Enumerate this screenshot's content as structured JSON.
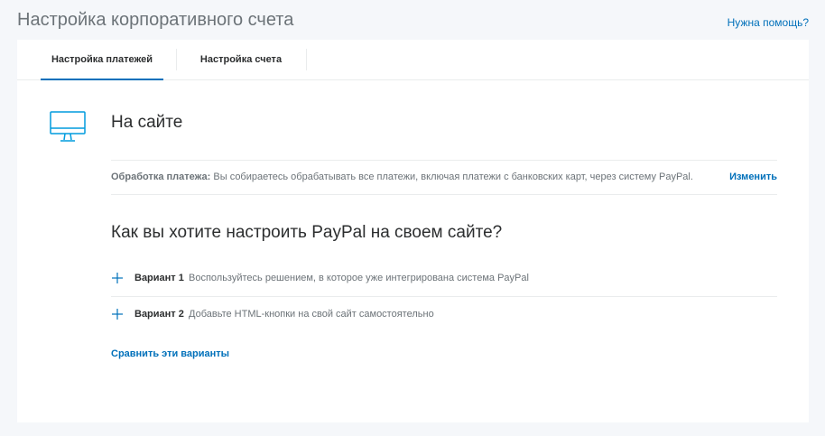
{
  "header": {
    "title": "Настройка корпоративного счета",
    "help_link": "Нужна помощь?"
  },
  "tabs": [
    {
      "label": "Настройка платежей",
      "active": true
    },
    {
      "label": "Настройка счета",
      "active": false
    }
  ],
  "section": {
    "icon": "monitor-icon",
    "title": "На сайте",
    "processing_label": "Обработка платежа:",
    "processing_text": "Вы собираетесь обрабатывать все платежи, включая платежи с банковских карт, через систему PayPal.",
    "change_link": "Изменить"
  },
  "question": {
    "title": "Как вы хотите настроить PayPal на своем сайте?"
  },
  "options": [
    {
      "label": "Вариант 1",
      "description": "Воспользуйтесь решением, в которое уже интегрирована система PayPal",
      "icon": "plus-icon"
    },
    {
      "label": "Вариант 2",
      "description": "Добавьте HTML-кнопки на свой сайт самостоятельно",
      "icon": "plus-icon"
    }
  ],
  "compare_link": "Сравнить эти варианты",
  "colors": {
    "accent": "#0070ba",
    "icon": "#009cde",
    "background": "#f5f7fa"
  }
}
